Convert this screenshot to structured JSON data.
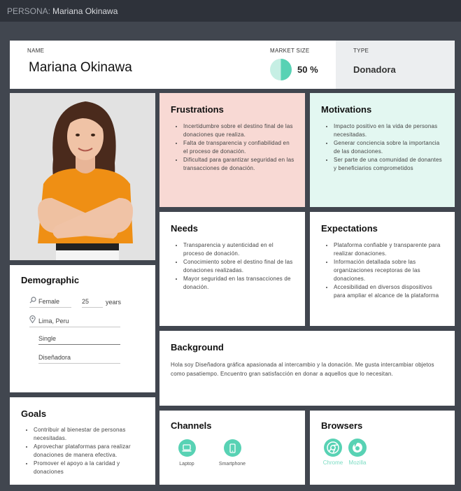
{
  "topbar": {
    "prefix": "PERSONA:",
    "name": "Mariana Okinawa"
  },
  "header": {
    "name_label": "NAME",
    "name": "Mariana Okinawa",
    "market_label": "MARKET SIZE",
    "market_value": "50 %",
    "market_fraction": 0.5,
    "type_label": "TYPE",
    "type_value": "Donadora"
  },
  "frustrations": {
    "title": "Frustrations",
    "items": [
      "Incertidumbre sobre el destino final de las donaciones que realiza.",
      "Falta de transparencia y confiabilidad en el proceso de donación.",
      "Dificultad para garantizar seguridad en las transacciones de donación."
    ]
  },
  "motivations": {
    "title": "Motivations",
    "items": [
      "Impacto positivo en la vida de personas necesitadas.",
      "Generar conciencia sobre la importancia de las donaciones.",
      "Ser parte de una comunidad de donantes y beneficiarios comprometidos"
    ]
  },
  "needs": {
    "title": "Needs",
    "items": [
      "Transparencia y autenticidad en el proceso de donación.",
      "Conocimiento sobre el destino final de las donaciones realizadas.",
      "Mayor seguridad en las transacciones de donación."
    ]
  },
  "expectations": {
    "title": "Expectations",
    "items": [
      "Plataforma confiable y transparente para realizar donaciones.",
      "Información detallada sobre las organizaciones receptoras de las donaciones.",
      "Accesibilidad en diversos dispositivos para ampliar el alcance de la plataforma"
    ]
  },
  "background": {
    "title": "Background",
    "text": "Hola soy Diseñadora gráfica apasionada al intercambio y la donación. Me gusta intercambiar objetos como pasatiempo. Encuentro gran satisfacción en donar a aquellos que lo necesitan."
  },
  "demographic": {
    "title": "Demographic",
    "gender": "Female",
    "age": "25",
    "age_unit": "years",
    "location": "Lima, Peru",
    "status": "Single",
    "occupation": "Diseñadora"
  },
  "goals": {
    "title": "Goals",
    "items": [
      "Contribuir al bienestar de personas necesitadas.",
      "Aprovechar plataformas para realizar donaciones de manera efectiva.",
      "Promover el apoyo a la caridad y donaciones"
    ]
  },
  "channels": {
    "title": "Channels",
    "items": [
      {
        "label": "Laptop",
        "icon": "laptop-icon"
      },
      {
        "label": "Smartphone",
        "icon": "smartphone-icon"
      }
    ]
  },
  "browsers": {
    "title": "Browsers",
    "items": [
      {
        "label": "Chrome",
        "icon": "chrome-icon"
      },
      {
        "label": "Mozilla",
        "icon": "firefox-icon"
      }
    ]
  },
  "colors": {
    "accent": "#58d2b4",
    "frustrations_bg": "#f8d9d4",
    "motivations_bg": "#e3f7f1",
    "page_bg": "#41464f"
  }
}
